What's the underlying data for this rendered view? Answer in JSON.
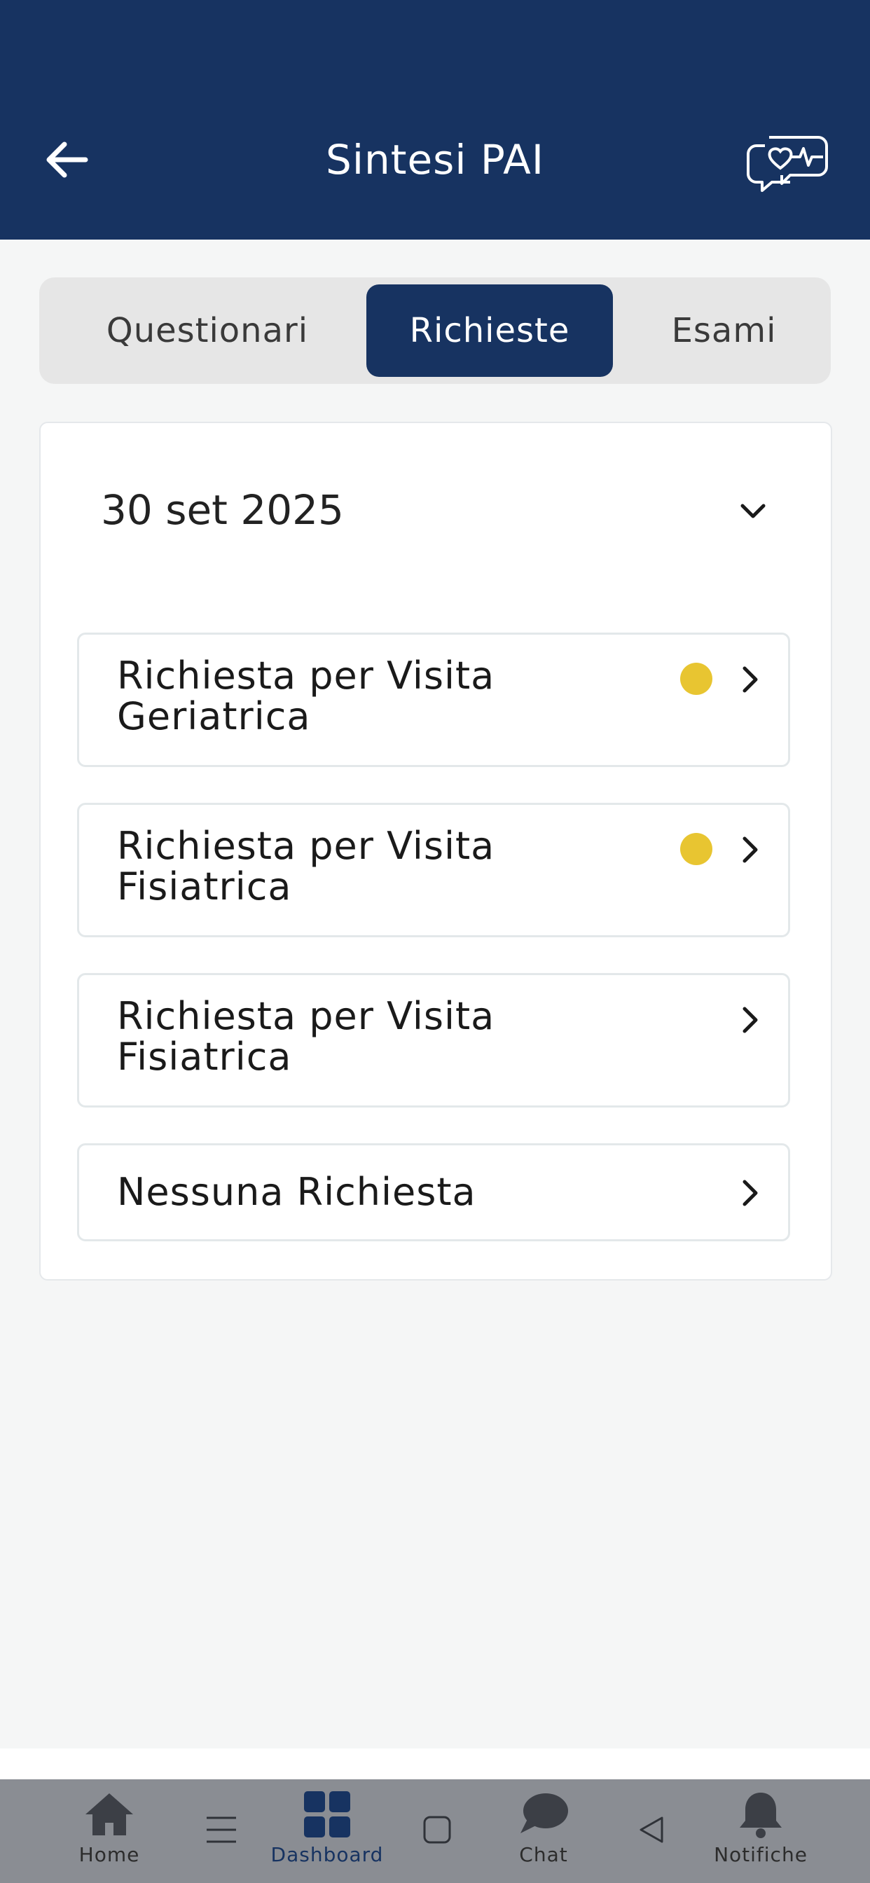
{
  "header": {
    "title": "Sintesi PAI",
    "back_icon": "arrow-left-icon",
    "action_icon": "chat-heart-icon",
    "background": "#173361"
  },
  "tabs": [
    {
      "label": "Questionari",
      "active": false
    },
    {
      "label": "Richieste",
      "active": true
    },
    {
      "label": "Esami",
      "active": false
    }
  ],
  "section": {
    "date": "30 set 2025",
    "expanded": true
  },
  "requests": [
    {
      "line1": "Richiesta per Visita",
      "line2": "Geriatrica",
      "status_dot": true
    },
    {
      "line1": "Richiesta per Visita",
      "line2": "Fisiatrica",
      "status_dot": true
    },
    {
      "line1": "Richiesta per Visita",
      "line2": "Fisiatrica",
      "status_dot": false
    },
    {
      "line1": "Nessuna Richiesta",
      "line2": "",
      "status_dot": false
    }
  ],
  "colors": {
    "accent": "#173361",
    "status_dot": "#e8c531",
    "nav_bar": "#8a8d93"
  },
  "bottom_nav": {
    "items": [
      {
        "label": "Home",
        "icon": "home-icon",
        "active": false
      },
      {
        "label": "Dashboard",
        "icon": "dashboard-icon",
        "active": true
      },
      {
        "label": "Chat",
        "icon": "chat-icon",
        "active": false
      },
      {
        "label": "Notifiche",
        "icon": "bell-icon",
        "active": false
      }
    ],
    "system_buttons": [
      "menu-icon",
      "square-home-icon",
      "triangle-back-icon"
    ]
  }
}
